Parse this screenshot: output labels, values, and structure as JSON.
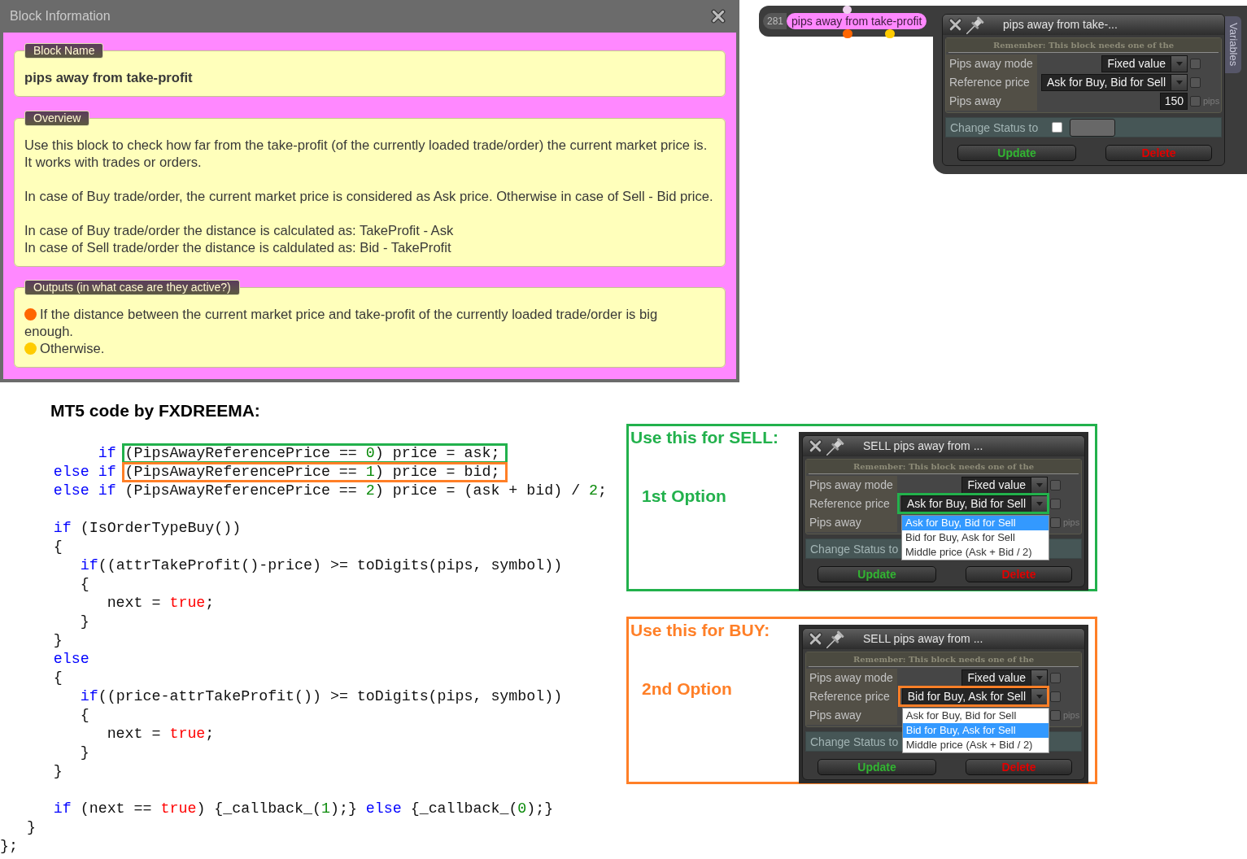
{
  "block_information": {
    "title": "Block Information",
    "block_name": {
      "legend": "Block Name",
      "text": "pips away from take-profit"
    },
    "overview": {
      "legend": "Overview",
      "paragraphs": [
        {
          "lines": [
            "Use this block to check how far from the take-profit (of the currently loaded trade/order) the current market price is. It works with trades or orders."
          ]
        },
        {
          "lines": [
            "In case of Buy trade/order, the current market price is considered as Ask price. Otherwise in case of Sell - Bid price."
          ]
        },
        {
          "lines": [
            "In case of Buy trade/order the distance is calculated as: TakeProfit - Ask",
            "In case of Sell trade/order the distance is caldulated as: Bid - TakeProfit"
          ]
        }
      ]
    },
    "outputs": {
      "legend": "Outputs (in what case are they active?)",
      "items": [
        {
          "color": "#ff6600",
          "text": "If the distance between the current market price and take-profit of the currently loaded trade/order is big enough."
        },
        {
          "color": "#ffcc00",
          "text": "Otherwise."
        }
      ]
    }
  },
  "block_node": {
    "number": "281",
    "label": "pips away from take-profit",
    "outputs": [
      {
        "color": "#ff6600"
      },
      {
        "color": "#ffcc00"
      }
    ]
  },
  "settings_panel": {
    "title": "pips away from take-...",
    "notice": "Remember: This block needs one of the",
    "fields": [
      {
        "kind": "select",
        "label": "Pips away mode",
        "value": "Fixed value",
        "checked": false
      },
      {
        "kind": "select",
        "label": "Reference price",
        "value": "Ask for Buy, Bid for Sell",
        "checked": false
      },
      {
        "kind": "number",
        "label": "Pips away",
        "value": "150",
        "unit": "pips",
        "checked": false
      }
    ],
    "status": {
      "label": "Change Status to",
      "checked": false
    },
    "buttons": [
      {
        "kind": "update",
        "label": "Update"
      },
      {
        "kind": "delete",
        "label": "Delete"
      }
    ],
    "side_tab": "Variables"
  },
  "code_section": {
    "title": "MT5 code by FXDREEMA:",
    "blocks": [
      {
        "lines": [
          {
            "tokens": [
              {
                "kind": "keyword",
                "text": "           if "
              }
            ],
            "framed_tokens": [
              {
                "kind": "plain",
                "text": "(PipsAwayReferencePrice == "
              },
              {
                "kind": "number",
                "text": "0"
              },
              {
                "kind": "plain",
                "text": ") price = ask;"
              }
            ],
            "color": "#22b14c"
          },
          {
            "tokens": [
              {
                "kind": "keyword",
                "text": "      else if "
              }
            ],
            "framed_tokens": [
              {
                "kind": "plain",
                "text": "(PipsAwayReferencePrice == "
              },
              {
                "kind": "number",
                "text": "1"
              },
              {
                "kind": "plain",
                "text": ") price = bid;"
              }
            ],
            "color": "#ff7f27"
          },
          {
            "tokens": [
              {
                "kind": "keyword",
                "text": "      else if "
              },
              {
                "kind": "plain",
                "text": "(PipsAwayReferencePrice == "
              },
              {
                "kind": "number",
                "text": "2"
              },
              {
                "kind": "plain",
                "text": ") price = (ask + bid) / "
              },
              {
                "kind": "number",
                "text": "2"
              },
              {
                "kind": "plain",
                "text": ";"
              }
            ]
          }
        ]
      },
      {
        "lines": [
          {
            "tokens": [
              {
                "kind": "keyword",
                "text": "      if "
              },
              {
                "kind": "plain",
                "text": "(IsOrderTypeBuy())"
              }
            ]
          },
          {
            "tokens": [
              {
                "kind": "plain",
                "text": "      {"
              }
            ]
          },
          {
            "tokens": [
              {
                "kind": "keyword",
                "text": "         if"
              },
              {
                "kind": "plain",
                "text": "((attrTakeProfit()-price) >= toDigits(pips, symbol))"
              }
            ]
          },
          {
            "tokens": [
              {
                "kind": "plain",
                "text": "         {"
              }
            ]
          },
          {
            "tokens": [
              {
                "kind": "plain",
                "text": "            next = "
              },
              {
                "kind": "literal",
                "text": "true"
              },
              {
                "kind": "plain",
                "text": ";"
              }
            ]
          },
          {
            "tokens": [
              {
                "kind": "plain",
                "text": "         }"
              }
            ]
          },
          {
            "tokens": [
              {
                "kind": "plain",
                "text": "      }"
              }
            ]
          },
          {
            "tokens": [
              {
                "kind": "keyword",
                "text": "      else"
              }
            ]
          },
          {
            "tokens": [
              {
                "kind": "plain",
                "text": "      {"
              }
            ]
          },
          {
            "tokens": [
              {
                "kind": "keyword",
                "text": "         if"
              },
              {
                "kind": "plain",
                "text": "((price-attrTakeProfit()) >= toDigits(pips, symbol))"
              }
            ]
          },
          {
            "tokens": [
              {
                "kind": "plain",
                "text": "         {"
              }
            ]
          },
          {
            "tokens": [
              {
                "kind": "plain",
                "text": "            next = "
              },
              {
                "kind": "literal",
                "text": "true"
              },
              {
                "kind": "plain",
                "text": ";"
              }
            ]
          },
          {
            "tokens": [
              {
                "kind": "plain",
                "text": "         }"
              }
            ]
          },
          {
            "tokens": [
              {
                "kind": "plain",
                "text": "      }"
              }
            ]
          }
        ]
      },
      {
        "lines": [
          {
            "tokens": [
              {
                "kind": "keyword",
                "text": "      if "
              },
              {
                "kind": "plain",
                "text": "(next == "
              },
              {
                "kind": "literal",
                "text": "true"
              },
              {
                "kind": "plain",
                "text": ") {_callback_("
              },
              {
                "kind": "number",
                "text": "1"
              },
              {
                "kind": "plain",
                "text": ");} "
              },
              {
                "kind": "keyword",
                "text": "else"
              },
              {
                "kind": "plain",
                "text": " {_callback_("
              },
              {
                "kind": "number",
                "text": "0"
              },
              {
                "kind": "plain",
                "text": ");}"
              }
            ]
          },
          {
            "tokens": [
              {
                "kind": "plain",
                "text": "   }"
              }
            ]
          },
          {
            "tokens": [
              {
                "kind": "plain",
                "text": "};"
              }
            ]
          }
        ]
      }
    ]
  },
  "examples": [
    {
      "heading": "Use this for SELL:",
      "option": "1st Option",
      "color": "#22b14c",
      "panel": {
        "title": "SELL pips away from ...",
        "notice": "Remember: This block needs one of the",
        "fields": [
          {
            "kind": "select",
            "label": "Pips away mode",
            "value": "Fixed value",
            "checked": false
          },
          {
            "kind": "select",
            "label": "Reference price",
            "value": "Ask for Buy, Bid for Sell",
            "options": [
              {
                "label": "Ask for Buy, Bid for Sell",
                "selected": true
              },
              {
                "label": "Bid for Buy, Ask for Sell",
                "selected": false
              },
              {
                "label": "Middle price (Ask + Bid / 2)",
                "selected": false
              }
            ],
            "checked": false
          },
          {
            "kind": "number",
            "label": "Pips away",
            "unit": "pips",
            "checked": false
          }
        ],
        "status": {
          "label": "Change Status to"
        },
        "buttons": [
          {
            "kind": "update",
            "label": "Update"
          },
          {
            "kind": "delete",
            "label": "Delete"
          }
        ]
      }
    },
    {
      "heading": "Use this for BUY:",
      "option": "2nd Option",
      "color": "#ff7f27",
      "panel": {
        "title": "SELL pips away from ...",
        "notice": "Remember: This block needs one of the",
        "fields": [
          {
            "kind": "select",
            "label": "Pips away mode",
            "value": "Fixed value",
            "checked": false
          },
          {
            "kind": "select",
            "label": "Reference price",
            "value": "Bid for Buy, Ask for Sell",
            "options": [
              {
                "label": "Ask for Buy, Bid for Sell",
                "selected": false
              },
              {
                "label": "Bid for Buy, Ask for Sell",
                "selected": true
              },
              {
                "label": "Middle price (Ask + Bid / 2)",
                "selected": false
              }
            ],
            "checked": false
          },
          {
            "kind": "number",
            "label": "Pips away",
            "unit": "pips",
            "checked": false
          }
        ],
        "status": {
          "label": "Change Status to"
        },
        "buttons": [
          {
            "kind": "update",
            "label": "Update"
          },
          {
            "kind": "delete",
            "label": "Delete"
          }
        ]
      }
    }
  ]
}
